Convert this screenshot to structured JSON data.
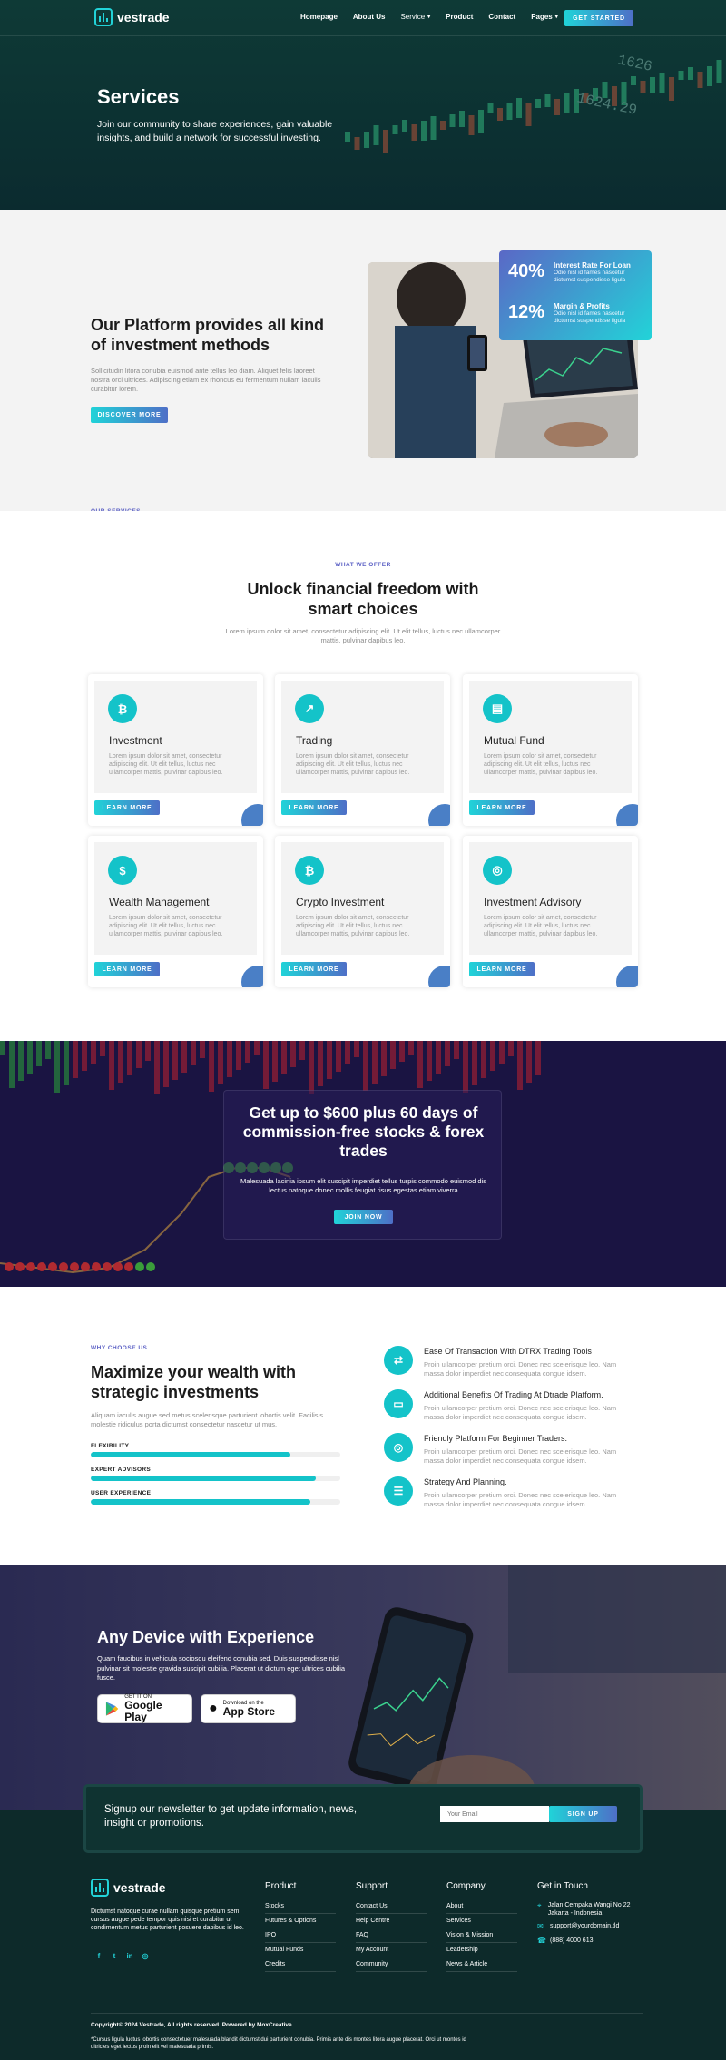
{
  "nav": {
    "brand": "vestrade",
    "links": [
      {
        "label": "Homepage",
        "has_dropdown": false
      },
      {
        "label": "About Us",
        "has_dropdown": false
      },
      {
        "label": "Service",
        "has_dropdown": true
      },
      {
        "label": "Product",
        "has_dropdown": false
      },
      {
        "label": "Contact",
        "has_dropdown": false
      },
      {
        "label": "Pages",
        "has_dropdown": true
      }
    ],
    "cta": "GET STARTED"
  },
  "hero": {
    "title": "Services",
    "subtitle": "Join our community to share experiences, gain valuable insights, and build a network for successful investing.",
    "ticker_numbers": [
      "1626",
      "1624.29"
    ]
  },
  "platform": {
    "eyebrow": "OUR SERVICES",
    "title": "Our Platform provides all kind of investment methods",
    "description": "Sollicitudin litora conubia euismod ante tellus leo diam. Aliquet felis laoreet nostra orci ultrices. Adipiscing etiam ex rhoncus eu fermentum nullam iaculis curabitur lorem.",
    "button": "DISCOVER MORE",
    "stats": [
      {
        "value": "40%",
        "title": "Interest Rate For Loan",
        "text": "Odio nisl id fames nascetur dictumst suspendisse ligula"
      },
      {
        "value": "12%",
        "title": "Margin & Profits",
        "text": "Odio nisl id fames nascetur dictumst suspendisse ligula"
      }
    ]
  },
  "offer": {
    "eyebrow": "WHAT WE OFFER",
    "title": "Unlock financial freedom with smart choices",
    "subtitle": "Lorem ipsum dolor sit amet, consectetur adipiscing elit. Ut elit tellus, luctus nec ullamcorper mattis, pulvinar dapibus leo.",
    "cards": [
      {
        "icon": "bitcoin-icon",
        "glyph": "₿",
        "title": "Investment",
        "desc": "Lorem ipsum dolor sit amet, consectetur adipiscing elit. Ut elit tellus, luctus nec ullamcorper mattis, pulvinar dapibus leo.",
        "button": "LEARN MORE"
      },
      {
        "icon": "chart-line-icon",
        "glyph": "↗",
        "title": "Trading",
        "desc": "Lorem ipsum dolor sit amet, consectetur adipiscing elit. Ut elit tellus, luctus nec ullamcorper mattis, pulvinar dapibus leo.",
        "button": "LEARN MORE"
      },
      {
        "icon": "document-chart-icon",
        "glyph": "▤",
        "title": "Mutual Fund",
        "desc": "Lorem ipsum dolor sit amet, consectetur adipiscing elit. Ut elit tellus, luctus nec ullamcorper mattis, pulvinar dapibus leo.",
        "button": "LEARN MORE"
      },
      {
        "icon": "money-hand-icon",
        "glyph": "$",
        "title": "Wealth Management",
        "desc": "Lorem ipsum dolor sit amet, consectetur adipiscing elit. Ut elit tellus, luctus nec ullamcorper mattis, pulvinar dapibus leo.",
        "button": "LEARN MORE"
      },
      {
        "icon": "crypto-coin-icon",
        "glyph": "₿",
        "title": "Crypto Investment",
        "desc": "Lorem ipsum dolor sit amet, consectetur adipiscing elit. Ut elit tellus, luctus nec ullamcorper mattis, pulvinar dapibus leo.",
        "button": "LEARN MORE"
      },
      {
        "icon": "advisory-icon",
        "glyph": "◎",
        "title": "Investment Advisory",
        "desc": "Lorem ipsum dolor sit amet, consectetur adipiscing elit. Ut elit tellus, luctus nec ullamcorper mattis, pulvinar dapibus leo.",
        "button": "LEARN MORE"
      }
    ]
  },
  "promo": {
    "title": "Get up to $600 plus 60 days of commission-free stocks & forex trades",
    "subtitle": "Malesuada lacinia ipsum elit suscipit imperdiet tellus turpis commodo euismod dis lectus natoque donec mollis feugiat risus egestas etiam viverra",
    "button": "JOIN NOW"
  },
  "why": {
    "eyebrow": "WHY CHOOSE US",
    "title": "Maximize your wealth with strategic investments",
    "description": "Aliquam iaculis augue sed metus scelerisque parturient lobortis velit. Facilisis molestie ridiculus porta dictumst consectetur nascetur ut mus.",
    "bars": [
      {
        "label": "FLEXIBILITY",
        "value": 0.8
      },
      {
        "label": "EXPERT ADVISORS",
        "value": 0.9
      },
      {
        "label": "USER EXPERIENCE",
        "value": 0.88
      }
    ],
    "features": [
      {
        "icon": "transaction-icon",
        "glyph": "⇄",
        "title": "Ease Of Transaction With DTRX Trading Tools",
        "desc": "Proin ullamcorper pretium orci. Donec nec scelerisque leo. Nam massa dolor imperdiet nec consequata congue idsem."
      },
      {
        "icon": "monitor-icon",
        "glyph": "▭",
        "title": "Additional Benefits Of Trading At Dtrade Platform.",
        "desc": "Proin ullamcorper pretium orci. Donec nec scelerisque leo. Nam massa dolor imperdiet nec consequata congue idsem."
      },
      {
        "icon": "target-icon",
        "glyph": "◎",
        "title": "Friendly Platform For Beginner Traders.",
        "desc": "Proin ullamcorper pretium orci. Donec nec scelerisque leo. Nam massa dolor imperdiet nec consequata congue idsem."
      },
      {
        "icon": "strategy-icon",
        "glyph": "☰",
        "title": "Strategy And Planning.",
        "desc": "Proin ullamcorper pretium orci. Donec nec scelerisque leo. Nam massa dolor imperdiet nec consequata congue idsem."
      }
    ]
  },
  "device": {
    "title": "Any Device with Experience",
    "description": "Quam faucibus in vehicula sociosqu eleifend conubia sed. Duis suspendisse nisl pulvinar sit molestie gravida suscipit cubilia. Placerat ut dictum eget ultrices cubilia fusce.",
    "stores": [
      {
        "small": "GET IT ON",
        "big": "Google Play",
        "icon": "google-play-icon"
      },
      {
        "small": "Download on the",
        "big": "App Store",
        "icon": "apple-icon"
      }
    ]
  },
  "newsletter": {
    "text": "Signup our newsletter to get update information, news, insight or promotions.",
    "placeholder": "Your Email",
    "button": "SIGN UP"
  },
  "footer": {
    "brand": "vestrade",
    "about": "Dictumst natoque curae nullam quisque pretium sem cursus augue pede tempor quis nisi et curabitur ut condimentum metus parturient posuere dapibus id leo.",
    "columns": [
      {
        "title": "Product",
        "items": [
          "Stocks",
          "Futures & Options",
          "IPO",
          "Mutual Funds",
          "Credits"
        ]
      },
      {
        "title": "Support",
        "items": [
          "Contact Us",
          "Help Centre",
          "FAQ",
          "My Account",
          "Community"
        ]
      },
      {
        "title": "Company",
        "items": [
          "About",
          "Services",
          "Vision & Mission",
          "Leadership",
          "News & Article"
        ]
      }
    ],
    "contact_title": "Get in Touch",
    "contacts": [
      {
        "icon": "location-icon",
        "glyph": "⌖",
        "text": "Jalan Cempaka Wangi No 22 Jakarta - Indonesia"
      },
      {
        "icon": "mail-icon",
        "glyph": "✉",
        "text": "support@yourdomain.tld"
      },
      {
        "icon": "phone-icon",
        "glyph": "☎",
        "text": "(888) 4000 613"
      }
    ],
    "copyright": "Copyright© 2024 Vestrade, All rights reserved. Powered by MoxCreative.",
    "note": "*Cursus ligula luctus lobortis consectetuer malesuada blandit dictumst dui parturient conubia. Primis ante dis montes litora augue placerat. Orci ut montes id ultricies eget lectus proin elit vel malesuada primis."
  },
  "colors": {
    "accent_teal": "#22d3d8",
    "accent_indigo": "#4e6fc7",
    "hero_bg": "#0e3a36",
    "footer_bg": "#0d2a2a"
  }
}
